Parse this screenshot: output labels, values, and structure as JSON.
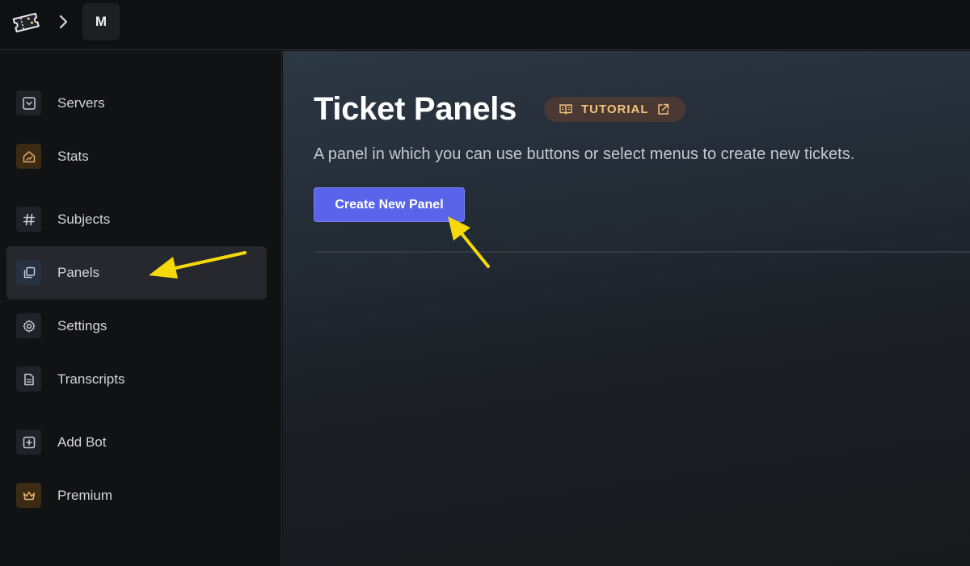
{
  "topbar": {
    "server_initial": "M"
  },
  "sidebar": {
    "items": [
      {
        "label": "Servers",
        "icon": "chevron-square-icon"
      },
      {
        "label": "Stats",
        "icon": "home-chart-icon"
      },
      {
        "label": "Subjects",
        "icon": "hash-icon"
      },
      {
        "label": "Panels",
        "icon": "copy-icon"
      },
      {
        "label": "Settings",
        "icon": "gear-icon"
      },
      {
        "label": "Transcripts",
        "icon": "document-icon"
      },
      {
        "label": "Add Bot",
        "icon": "plus-square-icon"
      },
      {
        "label": "Premium",
        "icon": "crown-icon"
      }
    ],
    "active": "Panels"
  },
  "main": {
    "title": "Ticket Panels",
    "tutorial_label": "TUTORIAL",
    "subtitle": "A panel in which you can use buttons or select menus to create new tickets.",
    "create_button": "Create New Panel"
  },
  "colors": {
    "accent": "#5a64ea",
    "tutorial_bg": "#4a3832",
    "tutorial_text": "#f1c27d",
    "annotation_arrow": "#f5d90a"
  }
}
